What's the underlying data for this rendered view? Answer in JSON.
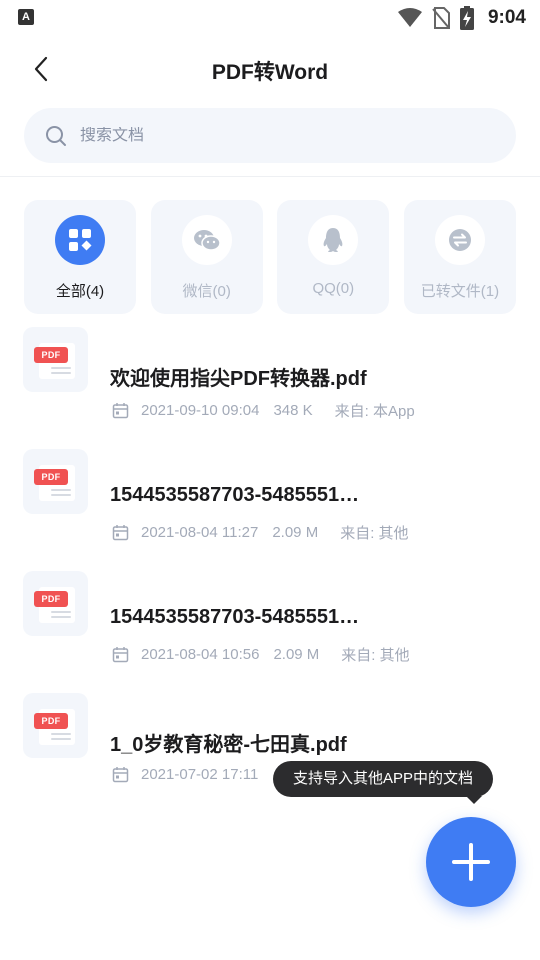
{
  "status_bar": {
    "time": "9:04",
    "left_badge": "A"
  },
  "header": {
    "title": "PDF转Word"
  },
  "search": {
    "placeholder": "搜索文档",
    "value": ""
  },
  "categories": [
    {
      "label": "全部(4)",
      "icon": "grid-icon",
      "active": true
    },
    {
      "label": "微信(0)",
      "icon": "wechat-icon",
      "active": false
    },
    {
      "label": "QQ(0)",
      "icon": "qq-icon",
      "active": false
    },
    {
      "label": "已转文件(1)",
      "icon": "convert-icon",
      "active": false
    }
  ],
  "files": [
    {
      "name": "欢迎使用指尖PDF转换器.pdf",
      "date": "2021-09-10 09:04",
      "size": "348 K",
      "source": "来自: 本App",
      "tag": "PDF"
    },
    {
      "name": "1544535587703-5485551…",
      "date": "2021-08-04 11:27",
      "size": "2.09 M",
      "source": "来自: 其他",
      "tag": "PDF"
    },
    {
      "name": "1544535587703-5485551…",
      "date": "2021-08-04 10:56",
      "size": "2.09 M",
      "source": "来自: 其他",
      "tag": "PDF"
    },
    {
      "name": "1_0岁教育秘密-七田真.pdf",
      "date": "2021-07-02 17:11",
      "size": "",
      "source": "",
      "tag": "PDF"
    }
  ],
  "tooltip": {
    "text": "支持导入其他APP中的文档"
  },
  "colors": {
    "accent": "#3f7cf3",
    "pdf_tag": "#f05252",
    "panel": "#f3f6fb"
  }
}
